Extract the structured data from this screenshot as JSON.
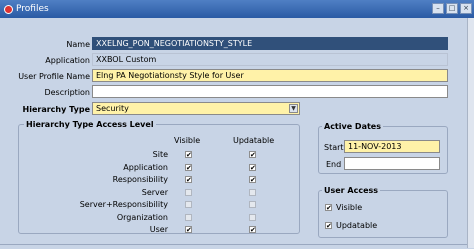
{
  "window": {
    "title": "Profiles"
  },
  "form": {
    "name": {
      "label": "Name",
      "value": "XXELNG_PON_NEGOTIATIONSTY_STYLE"
    },
    "application": {
      "label": "Application",
      "value": "XXBOL Custom"
    },
    "user_profile_name": {
      "label": "User Profile Name",
      "value": "Elng PA Negotiationsty Style for User"
    },
    "description": {
      "label": "Description",
      "value": ""
    },
    "hierarchy_type": {
      "label": "Hierarchy Type",
      "value": "Security"
    }
  },
  "access_level": {
    "title": "Hierarchy Type Access Level",
    "col_visible": "Visible",
    "col_updatable": "Updatable",
    "rows": [
      {
        "label": "Site",
        "visible": true,
        "updatable": true
      },
      {
        "label": "Application",
        "visible": true,
        "updatable": true
      },
      {
        "label": "Responsibility",
        "visible": true,
        "updatable": true
      },
      {
        "label": "Server",
        "visible": false,
        "updatable": false
      },
      {
        "label": "Server+Responsibility",
        "visible": false,
        "updatable": false
      },
      {
        "label": "Organization",
        "visible": false,
        "updatable": false
      },
      {
        "label": "User",
        "visible": true,
        "updatable": true
      }
    ]
  },
  "active_dates": {
    "title": "Active Dates",
    "start_label": "Start",
    "start_value": "11-NOV-2013",
    "end_label": "End",
    "end_value": ""
  },
  "user_access": {
    "title": "User Access",
    "visible_label": "Visible",
    "visible_checked": true,
    "updatable_label": "Updatable",
    "updatable_checked": true
  },
  "icons": {
    "window": "oracle-icon",
    "checkmark": "✔"
  }
}
